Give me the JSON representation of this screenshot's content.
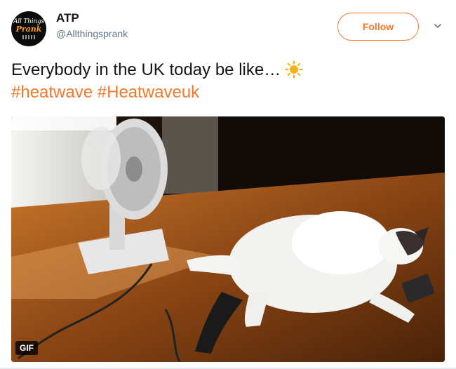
{
  "author": {
    "avatar_text_line1": "All Things",
    "avatar_text_line2": "Prank",
    "name": "ATP",
    "handle": "@Allthingsprank"
  },
  "follow_label": "Follow",
  "tweet": {
    "text": "Everybody in the UK today be like…",
    "emoji": "sun-icon",
    "hashtags": [
      "#heatwave",
      "#Heatwaveuk"
    ]
  },
  "media": {
    "type": "gif",
    "badge": "GIF",
    "description": "cat-lying-on-floor-in-front-of-fan"
  },
  "colors": {
    "accent": "#f4782c",
    "text": "#14171a",
    "muted": "#657786",
    "sun": "#f7b21a"
  }
}
